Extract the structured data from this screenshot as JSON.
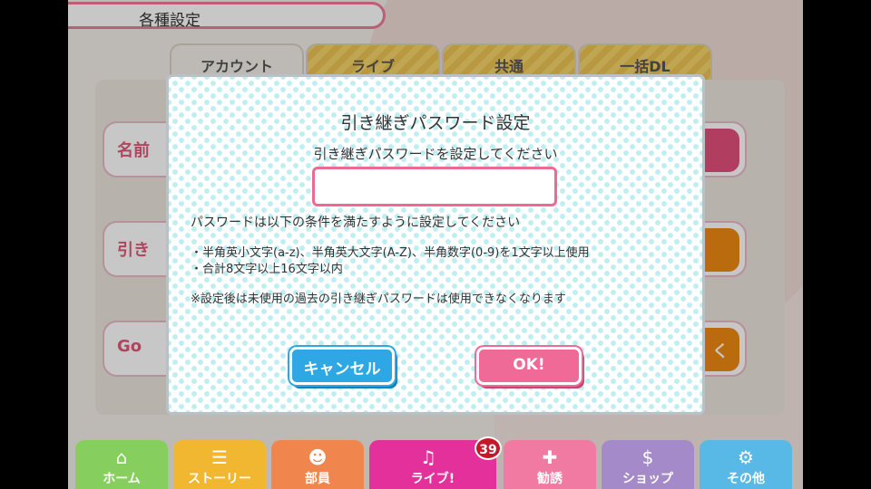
{
  "header": {
    "title": "各種設定"
  },
  "tabs": [
    {
      "label": "アカウント",
      "active": true
    },
    {
      "label": "ライブ",
      "active": false
    },
    {
      "label": "共通",
      "active": false
    },
    {
      "label": "一括DL",
      "active": false
    }
  ],
  "rows": [
    {
      "label": "名前",
      "button_color": "#e3507c"
    },
    {
      "label": "引き",
      "button_color": "#ef8a12"
    },
    {
      "label": "Go",
      "button_label": "く",
      "button_color": "#ef8a12"
    }
  ],
  "dialog": {
    "title": "引き継ぎパスワード設定",
    "subtitle": "引き継ぎパスワードを設定してください",
    "input_value": "",
    "conditions_intro": "パスワードは以下の条件を満たすように設定してください",
    "conditions": [
      "・半角英小文字(a-z)、半角英大文字(A-Z)、半角数字(0-9)を1文字以上使用",
      "・合計8文字以上16文字以内"
    ],
    "note": "※設定後は未使用の過去の引き継ぎパスワードは使用できなくなります",
    "cancel_label": "キャンセル",
    "ok_label": "OK!"
  },
  "nav": [
    {
      "label": "ホーム",
      "icon": "home-icon",
      "glyph": "⌂",
      "color": "#86cf5e"
    },
    {
      "label": "ストーリー",
      "icon": "story-icon",
      "glyph": "☰",
      "color": "#f2b730"
    },
    {
      "label": "部員",
      "icon": "members-icon",
      "glyph": "☻",
      "color": "#f0854e"
    },
    {
      "label": "ライブ!",
      "icon": "live-icon",
      "glyph": "♫",
      "color": "#e4309a"
    },
    {
      "label": "勧誘",
      "icon": "scout-icon",
      "glyph": "✚",
      "color": "#f07aa2"
    },
    {
      "label": "ショップ",
      "icon": "shop-icon",
      "glyph": "$",
      "color": "#a48ac8"
    },
    {
      "label": "その他",
      "icon": "other-icon",
      "glyph": "⚙",
      "color": "#58b8e6"
    }
  ],
  "live_badge": "39"
}
